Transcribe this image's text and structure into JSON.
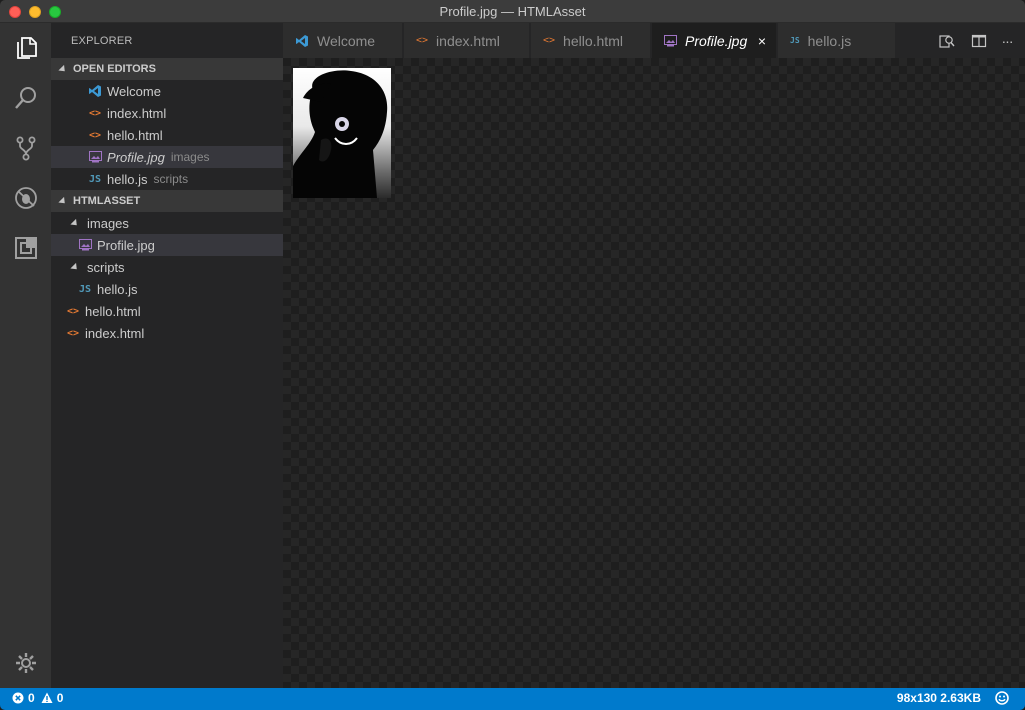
{
  "window": {
    "title": "Profile.jpg — HTMLAsset"
  },
  "activitybar": {
    "items": [
      {
        "name": "explorer-icon"
      },
      {
        "name": "search-icon"
      },
      {
        "name": "source-control-icon"
      },
      {
        "name": "debug-icon"
      },
      {
        "name": "extensions-icon"
      },
      {
        "name": "settings-gear-icon"
      }
    ]
  },
  "sidebar": {
    "title": "EXPLORER",
    "open_editors": {
      "header": "OPEN EDITORS",
      "items": [
        {
          "label": "Welcome",
          "detail": "",
          "icon": "vscode-icon"
        },
        {
          "label": "index.html",
          "detail": "",
          "icon": "html-file-icon"
        },
        {
          "label": "hello.html",
          "detail": "",
          "icon": "html-file-icon"
        },
        {
          "label": "Profile.jpg",
          "detail": "images",
          "icon": "image-file-icon"
        },
        {
          "label": "hello.js",
          "detail": "scripts",
          "icon": "js-file-icon"
        }
      ]
    },
    "workspace": {
      "header": "HTMLASSET",
      "tree": [
        {
          "label": "images",
          "type": "folder"
        },
        {
          "label": "Profile.jpg",
          "type": "image"
        },
        {
          "label": "scripts",
          "type": "folder"
        },
        {
          "label": "hello.js",
          "type": "js"
        },
        {
          "label": "hello.html",
          "type": "html"
        },
        {
          "label": "index.html",
          "type": "html"
        }
      ]
    }
  },
  "tabs": [
    {
      "label": "Welcome",
      "icon": "vscode-icon"
    },
    {
      "label": "index.html",
      "icon": "html-file-icon"
    },
    {
      "label": "hello.html",
      "icon": "html-file-icon"
    },
    {
      "label": "Profile.jpg",
      "icon": "image-file-icon",
      "active": true,
      "close": "×"
    },
    {
      "label": "hello.js",
      "icon": "js-file-icon"
    }
  ],
  "tab_actions": {
    "more": "···"
  },
  "icon_glyphs": {
    "html": "<>",
    "js": "JS"
  },
  "statusbar": {
    "errors": "0",
    "warnings": "0",
    "image_info": "98x130 2.63KB"
  },
  "colors": {
    "accent": "#007acc",
    "html_icon": "#e37933",
    "js_icon": "#519aba",
    "image_icon": "#a074c4",
    "vscode_icon": "#3c99d4"
  }
}
